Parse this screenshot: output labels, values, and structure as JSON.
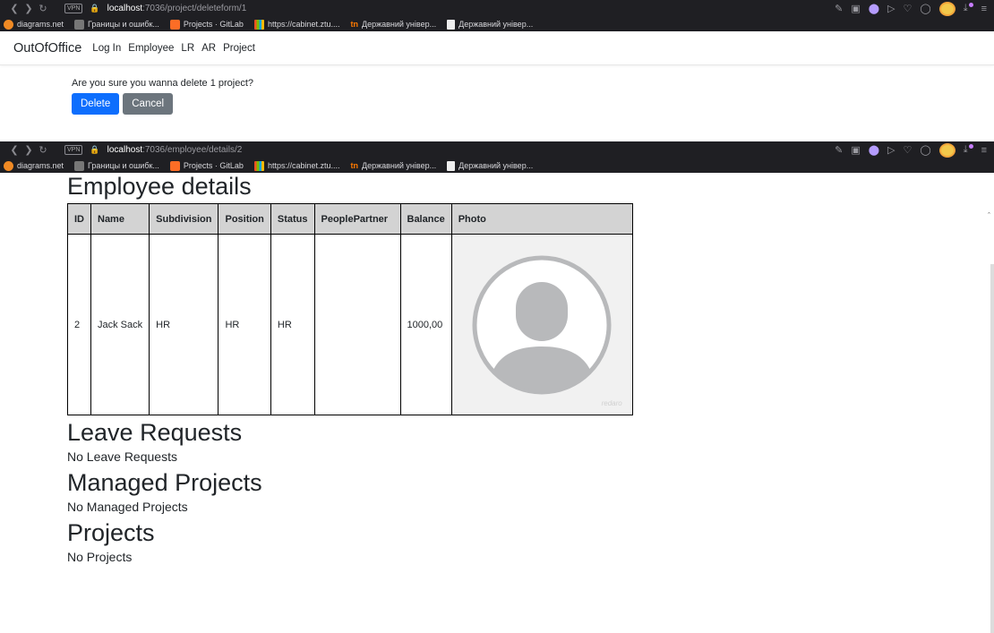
{
  "browser1": {
    "url_host": "localhost",
    "url_path": ":7036/project/deleteform/1",
    "vpn_label": "VPN"
  },
  "browser2": {
    "url_host": "localhost",
    "url_path": ":7036/employee/details/2",
    "vpn_label": "VPN"
  },
  "bookmarks": [
    {
      "label": "diagrams.net",
      "icon": "diagrams-icon"
    },
    {
      "label": "Границы и ошибк...",
      "icon": "page-icon"
    },
    {
      "label": "Projects · GitLab",
      "icon": "gitlab-icon"
    },
    {
      "label": "https://cabinet.ztu....",
      "icon": "microsoft-icon"
    },
    {
      "label": "Державний універ...",
      "icon": "tn-icon"
    },
    {
      "label": "Державний універ...",
      "icon": "document-icon"
    }
  ],
  "nav": {
    "brand": "OutOfOffice",
    "links": [
      "Log In",
      "Employee",
      "LR",
      "AR",
      "Project"
    ]
  },
  "confirm": {
    "text": "Are you sure you wanna delete 1 project?",
    "delete_label": "Delete",
    "cancel_label": "Cancel"
  },
  "employee": {
    "title": "Employee details",
    "headers": [
      "ID",
      "Name",
      "Subdivision",
      "Position",
      "Status",
      "PeoplePartner",
      "Balance",
      "Photo"
    ],
    "row": [
      "2",
      "Jack Sack",
      "HR",
      "HR",
      "HR",
      "",
      "1000,00"
    ],
    "photo_watermark": "redaro"
  },
  "sections": {
    "leave_title": "Leave Requests",
    "leave_empty": "No Leave Requests",
    "managed_title": "Managed Projects",
    "managed_empty": "No Managed Projects",
    "projects_title": "Projects",
    "projects_empty": "No Projects"
  },
  "colors": {
    "primary": "#0d6efd",
    "secondary": "#6c757d",
    "header_bg": "#d3d3d3",
    "chrome_bg": "#1f1f23"
  }
}
